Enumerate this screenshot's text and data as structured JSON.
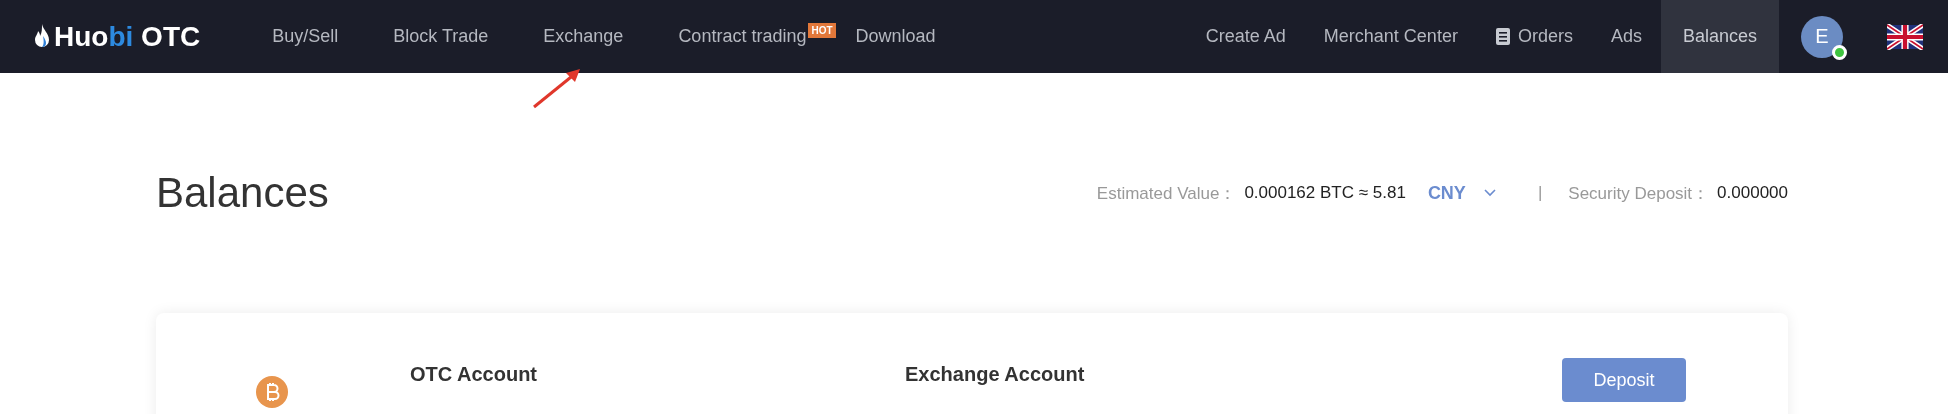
{
  "logo": {
    "brand_a": "Huo",
    "brand_b": "bi",
    "brand_c": " OTC"
  },
  "nav_left": [
    {
      "label": "Buy/Sell",
      "selected": false
    },
    {
      "label": "Block Trade",
      "selected": false
    },
    {
      "label": "Exchange",
      "selected": false
    },
    {
      "label": "Contract trading",
      "selected": false,
      "badge": "HOT"
    },
    {
      "label": "Download",
      "selected": false
    }
  ],
  "nav_right": [
    {
      "label": "Create Ad",
      "selected": false
    },
    {
      "label": "Merchant Center",
      "selected": false
    },
    {
      "label": "Orders",
      "selected": false,
      "kind": "icon"
    },
    {
      "label": "Ads",
      "selected": false
    },
    {
      "label": "Balances",
      "selected": true
    }
  ],
  "avatar": {
    "initial": "E",
    "online": true
  },
  "page_title": "Balances",
  "summary": {
    "estimated_label": "Estimated Value：",
    "estimated_value": "0.000162 BTC ≈ 5.81",
    "currency": "CNY",
    "separator": "|",
    "deposit_label": "Security Deposit：",
    "deposit_value": "0.000000"
  },
  "card": {
    "columns": [
      "OTC Account",
      "Exchange Account"
    ],
    "button": "Deposit"
  }
}
